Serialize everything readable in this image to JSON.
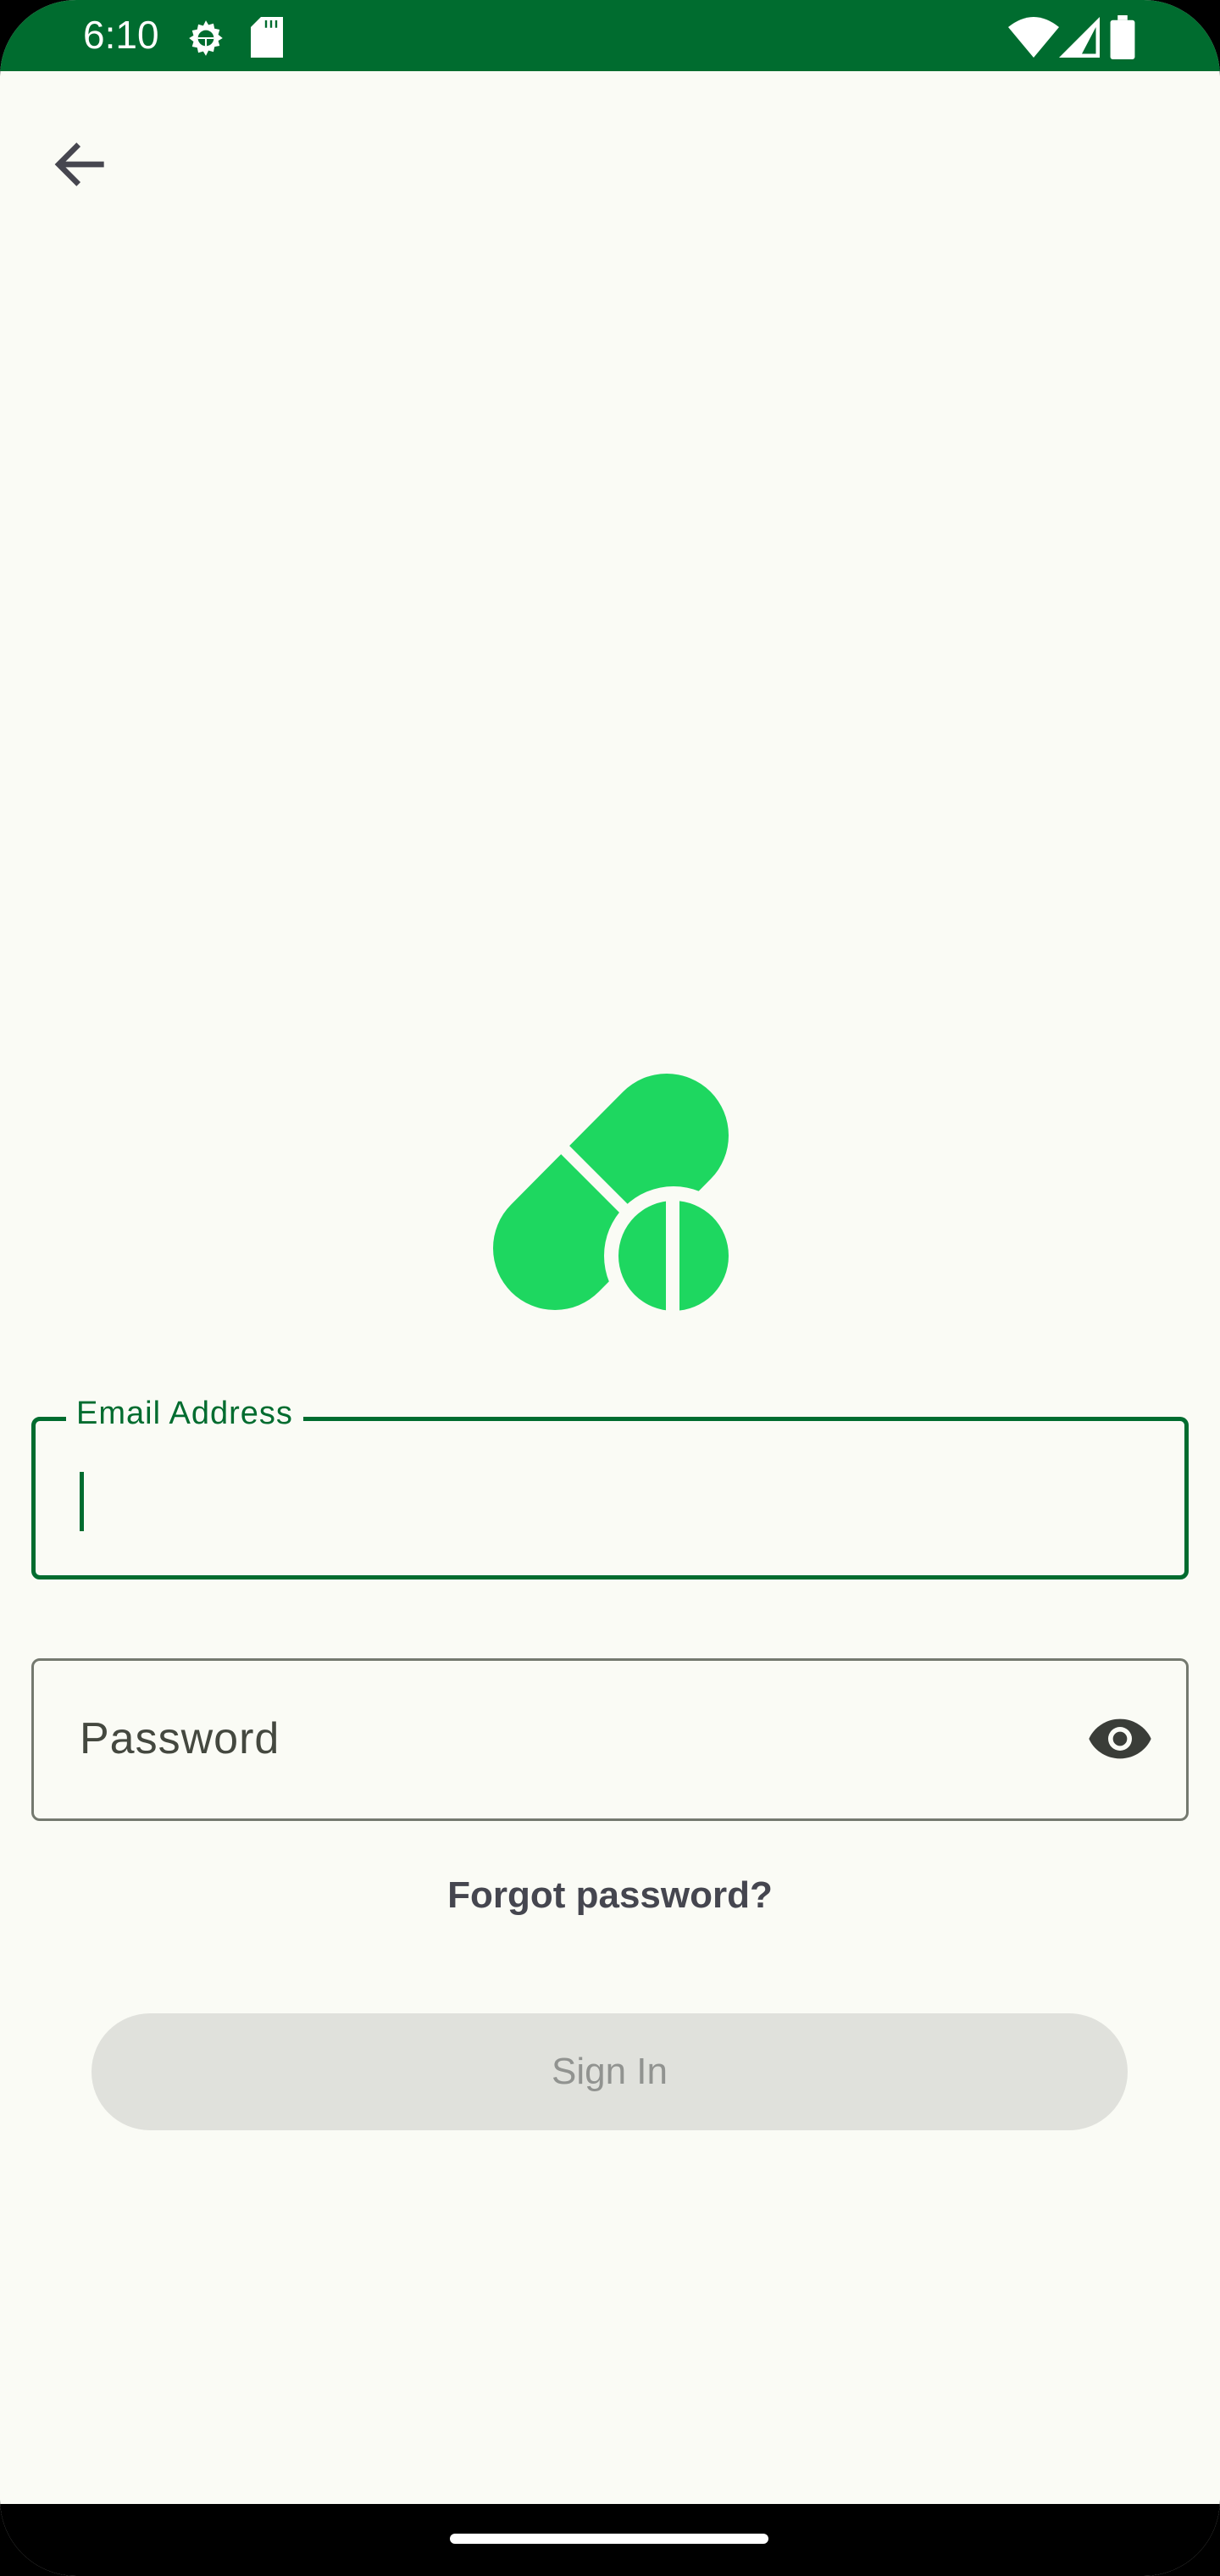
{
  "status_bar": {
    "time": "6:10",
    "icons": [
      "settings-gear-icon",
      "sd-card-icon",
      "wifi-icon",
      "cell-signal-icon",
      "battery-icon"
    ]
  },
  "header": {
    "back_icon": "arrow-back-icon"
  },
  "logo": {
    "icon": "pills-icon",
    "color": "#1ed760"
  },
  "form": {
    "email_label": "Email Address",
    "email_value": "",
    "password_placeholder": "Password",
    "password_toggle_icon": "eye-icon",
    "forgot_password": "Forgot password?",
    "sign_in": "Sign In"
  },
  "colors": {
    "primary": "#006c2f",
    "background": "#fafbf5",
    "logo": "#1ed760",
    "disabled_button": "#e0e1dc"
  }
}
